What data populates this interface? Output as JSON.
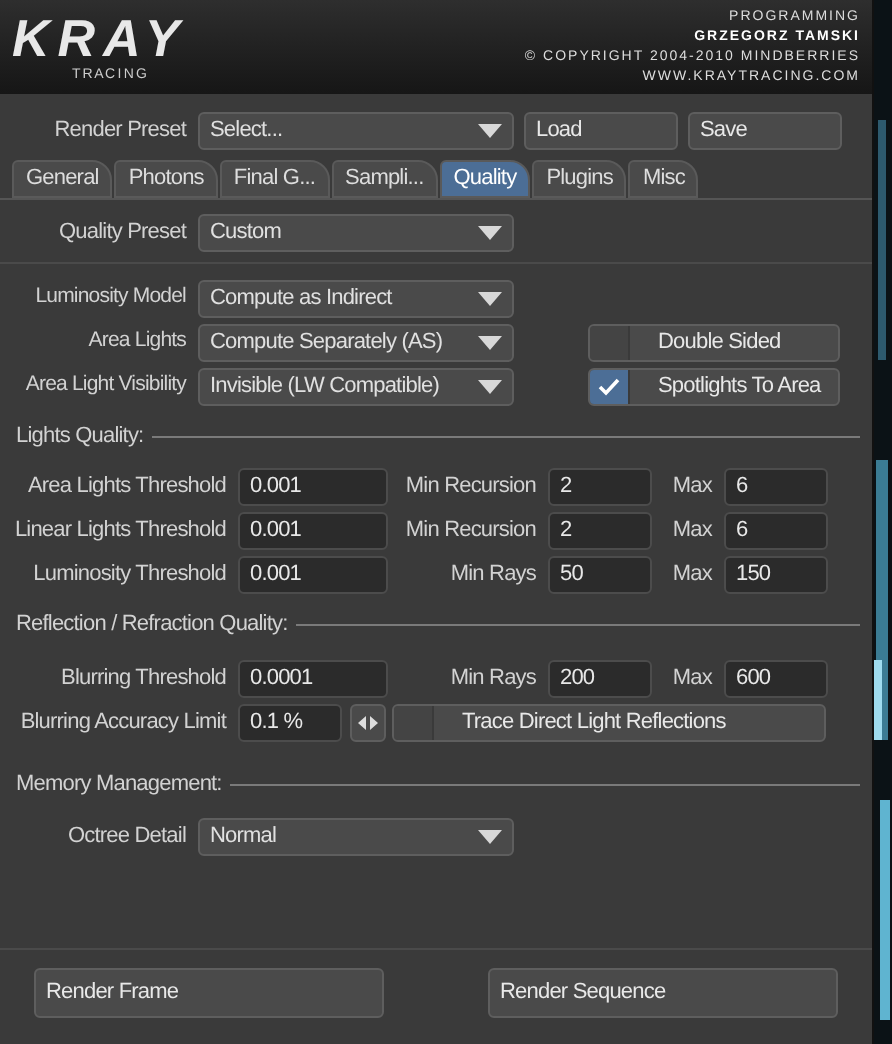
{
  "header": {
    "logo": "KRAY",
    "logo_sub": "T R A C I N G",
    "credits": [
      "PROGRAMMING",
      "GRZEGORZ TAMSKI",
      "© COPYRIGHT 2004-2010 MINDBERRIES",
      "WWW.KRAYTRACING.COM"
    ]
  },
  "render_preset": {
    "label": "Render Preset",
    "value": "Select...",
    "buttons": [
      "Load",
      "Save"
    ]
  },
  "tabs": [
    {
      "label": "General",
      "selected": false
    },
    {
      "label": "Photons",
      "selected": false
    },
    {
      "label": "Final G...",
      "selected": false
    },
    {
      "label": "Sampli...",
      "selected": false
    },
    {
      "label": "Quality",
      "selected": true
    },
    {
      "label": "Plugins",
      "selected": false
    },
    {
      "label": "Misc",
      "selected": false
    }
  ],
  "quality_preset": {
    "label": "Quality Preset",
    "value": "Custom"
  },
  "light_options": [
    {
      "label": "Luminosity Model",
      "value": "Compute as Indirect"
    },
    {
      "label": "Area Lights",
      "value": "Compute Separately (AS)",
      "toggle": {
        "label": "Double Sided",
        "checked": false
      }
    },
    {
      "label": "Area Light Visibility",
      "value": "Invisible (LW Compatible)",
      "toggle": {
        "label": "Spotlights To Area",
        "checked": true
      }
    }
  ],
  "lights_quality": {
    "title": "Lights Quality:",
    "rows": [
      {
        "label": "Area Lights Threshold",
        "value": "0.001",
        "min_label": "Min Recursion",
        "min_value": "2",
        "max_label": "Max",
        "max_value": "6"
      },
      {
        "label": "Linear Lights Threshold",
        "value": "0.001",
        "min_label": "Min Recursion",
        "min_value": "2",
        "max_label": "Max",
        "max_value": "6"
      },
      {
        "label": "Luminosity Threshold",
        "value": "0.001",
        "min_label": "Min Rays",
        "min_value": "50",
        "max_label": "Max",
        "max_value": "150"
      }
    ]
  },
  "reflection_quality": {
    "title": "Reflection / Refraction Quality:",
    "rows": [
      {
        "label": "Blurring Threshold",
        "value": "0.0001",
        "min_label": "Min Rays",
        "min_value": "200",
        "max_label": "Max",
        "max_value": "600"
      }
    ],
    "accuracy": {
      "label": "Blurring Accuracy Limit",
      "value": "0.1 %",
      "toggle": {
        "label": "Trace Direct Light Reflections",
        "checked": false
      }
    }
  },
  "memory": {
    "title": "Memory Management:",
    "label": "Octree Detail",
    "value": "Normal"
  },
  "footer_buttons": [
    "Render Frame",
    "Render Sequence"
  ]
}
